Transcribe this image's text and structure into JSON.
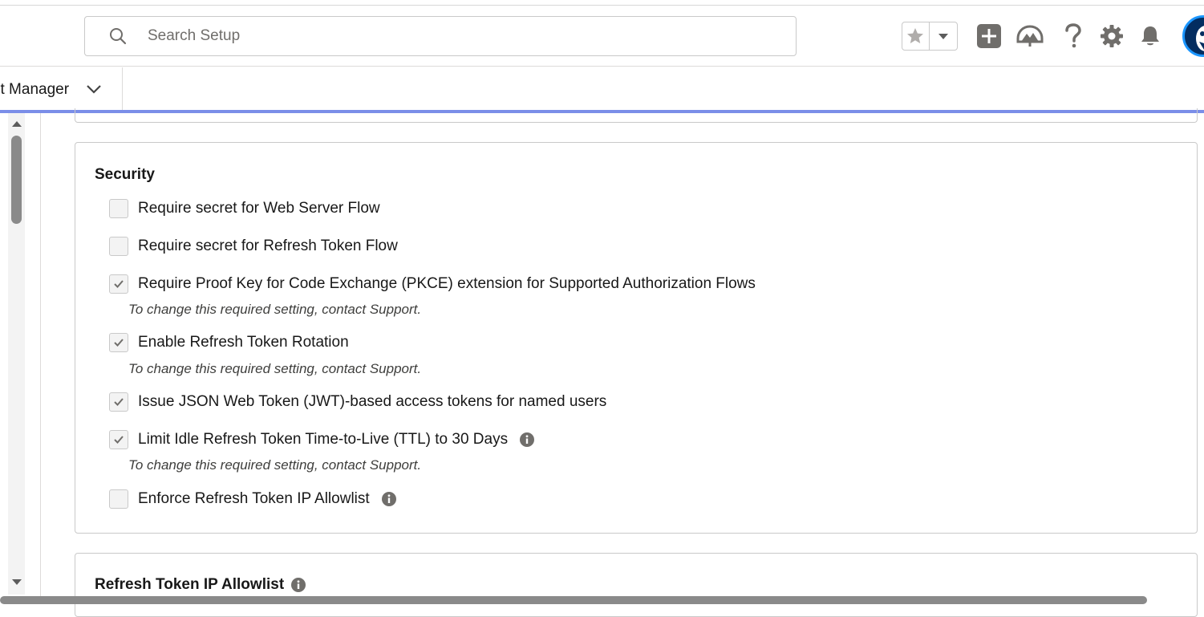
{
  "header": {
    "search_placeholder": "Search Setup",
    "icons": [
      "search-icon",
      "star-icon",
      "chevron-down-icon",
      "add-icon",
      "trailhead-icon",
      "help-icon",
      "gear-icon",
      "bell-icon",
      "avatar"
    ]
  },
  "nav": {
    "app_tab_label": "ct Manager"
  },
  "security": {
    "title": "Security",
    "options": [
      {
        "label": "Require secret for Web Server Flow",
        "checked": false
      },
      {
        "label": "Require secret for Refresh Token Flow",
        "checked": false
      },
      {
        "label": "Require Proof Key for Code Exchange (PKCE) extension for Supported Authorization Flows",
        "checked": true,
        "note": "To change this required setting, contact Support."
      },
      {
        "label": "Enable Refresh Token Rotation",
        "checked": true,
        "note": "To change this required setting, contact Support."
      },
      {
        "label": "Issue JSON Web Token (JWT)-based access tokens for named users",
        "checked": true
      },
      {
        "label": "Limit Idle Refresh Token Time-to-Live (TTL) to 30 Days",
        "checked": true,
        "note": "To change this required setting, contact Support."
      },
      {
        "label": "Enforce Refresh Token IP Allowlist",
        "checked": false
      }
    ]
  },
  "allowlist": {
    "title": "Refresh Token IP Allowlist"
  },
  "colors": {
    "accent_line": "#7b8ee8",
    "icon_gray": "#706e6b",
    "avatar_bg": "#032d60"
  }
}
